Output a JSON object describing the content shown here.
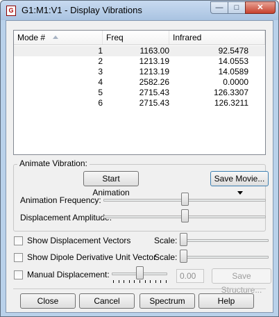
{
  "window": {
    "title": "G1:M1:V1 - Display Vibrations",
    "app_icon": "gaussview-icon"
  },
  "title_buttons": {
    "minimize": "—",
    "maximize": "□",
    "close": "✕"
  },
  "table": {
    "headers": [
      "Mode #",
      "Freq",
      "Infrared"
    ],
    "sorted_column": "Mode #",
    "selected_row": 0,
    "rows": [
      [
        "1",
        "1163.00",
        "92.5478"
      ],
      [
        "2",
        "1213.19",
        "14.0553"
      ],
      [
        "3",
        "1213.19",
        "14.0589"
      ],
      [
        "4",
        "2582.26",
        "0.0000"
      ],
      [
        "5",
        "2715.43",
        "126.3307"
      ],
      [
        "6",
        "2715.43",
        "126.3211"
      ]
    ]
  },
  "animate": {
    "group_label": "Animate Vibration:",
    "start_button": "Start Animation",
    "save_movie_button": "Save Movie...",
    "frequency_label": "Animation Frequency:",
    "frequency_level": 0.5,
    "amplitude_label": "Displacement Amplitude:",
    "amplitude_level": 0.5
  },
  "options": {
    "show_vectors_label": "Show Displacement Vectors",
    "show_vectors_checked": false,
    "vectors_scale_label": "Scale:",
    "vectors_scale_level": 0.0,
    "show_dipole_label": "Show Dipole Derivative Unit Vector",
    "show_dipole_checked": false,
    "dipole_scale_label": "Scale:",
    "dipole_scale_level": 0.0,
    "manual_label": "Manual Displacement:",
    "manual_checked": false,
    "manual_level": 0.5,
    "manual_value": "0.00",
    "save_structure_button": "Save Structure..."
  },
  "footer": {
    "close_button": "Close",
    "cancel_button": "Cancel",
    "spectrum_button": "Spectrum",
    "help_button": "Help"
  }
}
